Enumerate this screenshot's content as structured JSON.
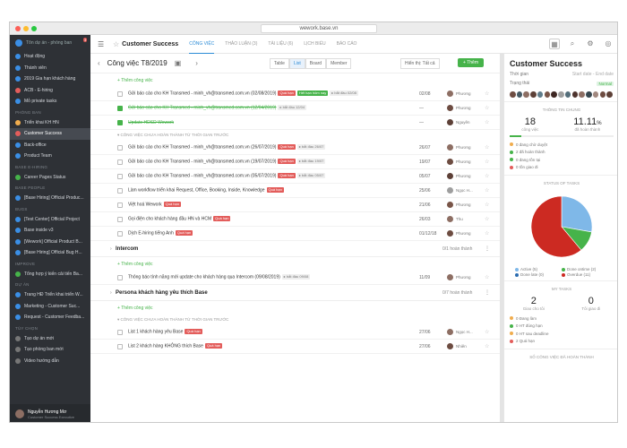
{
  "browser": {
    "url": "wework.base.vn"
  },
  "sidebar": {
    "org_name": "Tôn dự án - phòng ban",
    "badge": "3",
    "items_top": [
      {
        "label": "Hoạt động",
        "color": "#3b8fe6"
      },
      {
        "label": "Thành viên",
        "color": "#3b8fe6"
      },
      {
        "label": "2019 Gia hạn khách hàng",
        "color": "#3b8fe6"
      },
      {
        "label": "ACB - E-hiring",
        "color": "#e35d5b"
      },
      {
        "label": "Mỏ private tasks",
        "color": "#3b8fe6"
      }
    ],
    "head_phongban": "PHÒNG BAN",
    "items_phongban": [
      {
        "label": "Triển khai KH HN",
        "color": "#f0ad4e"
      },
      {
        "label": "Customer Success",
        "color": "#e35d5b",
        "active": true
      },
      {
        "label": "Back-office",
        "color": "#3b8fe6"
      },
      {
        "label": "Product Team",
        "color": "#3b8fe6"
      }
    ],
    "head_ehiring": "BASE E-HIRING",
    "items_ehiring": [
      {
        "label": "Career Pages Status",
        "color": "#46b34a"
      }
    ],
    "head_people": "BASE PEOPLE",
    "items_people": [
      {
        "label": "[Base Hiring] Official Produc...",
        "color": "#3b8fe6"
      }
    ],
    "head_bugs": "BUGS",
    "items_bugs": [
      {
        "label": "[Test Center] Official Project",
        "color": "#3b8fe6"
      },
      {
        "label": "Base inside v3",
        "color": "#3b8fe6"
      },
      {
        "label": "[Wework] Official Product B...",
        "color": "#3b8fe6"
      },
      {
        "label": "[Base Hiring] Official Bug H...",
        "color": "#3b8fe6"
      }
    ],
    "head_improve": "IMPROVE",
    "items_improve": [
      {
        "label": "Tổng hợp ý kiến cải tiến Ba...",
        "color": "#46b34a"
      }
    ],
    "head_duan": "DỰ ÁN",
    "items_duan": [
      {
        "label": "Trang HĐ Triển khai triển W...",
        "color": "#3b8fe6"
      },
      {
        "label": "Marketing - Customer Suc...",
        "color": "#3b8fe6"
      },
      {
        "label": "Request - Customer Feedba...",
        "color": "#3b8fe6"
      }
    ],
    "head_tuychon": "TÙY CHỌN",
    "items_tuychon": [
      {
        "label": "Tạo dự án mới",
        "color": "#777"
      },
      {
        "label": "Tạo phòng ban mới",
        "color": "#777"
      },
      {
        "label": "Video hướng dẫn",
        "color": "#777"
      }
    ],
    "user": {
      "name": "Nguyễn Hương Mơ",
      "role": "Customer Success Executive"
    }
  },
  "header": {
    "title": "Customer Success",
    "tabs": [
      "CÔNG VIỆC",
      "THẢO LUẬN (3)",
      "TÀI LIỆU (6)",
      "LỊCH BIỂU",
      "BÁO CÁO"
    ]
  },
  "toolbar": {
    "title": "Công việc T8/2019",
    "views": [
      "Table",
      "List",
      "Board",
      "Member"
    ],
    "filter": "Hiển thị: Tất cả",
    "add": "+ Thêm"
  },
  "add_task_label": "+ Thêm công việc",
  "overdue_label": "CÔNG VIỆC CHƯA HOÀN THÀNH TỪ THỜI GIAN TRƯỚC",
  "group1_tasks": [
    {
      "name": "Gửi báo cáo cho KH Transmed - minh_vh@transmed.com.vn (02/08/2019)",
      "tags": [
        [
          "Quá hạn",
          "red"
        ],
        [
          "Hết hạn hôm nay",
          "grn"
        ],
        [
          "▸ bắt đầu 02/08",
          "gray"
        ]
      ],
      "date": "02/08",
      "owner": "Phương",
      "done": false
    },
    {
      "name": "Gửi báo cáo cho KH Transmed - minh_vh@transmed.com.vn (12/04/2019)",
      "tags": [
        [
          "▸ bắt đầu 12/04",
          "gray"
        ]
      ],
      "date": "—",
      "owner": "Phương",
      "done": true
    },
    {
      "name": "Update HDSD Wework",
      "tags": [],
      "date": "—",
      "owner": "Nguyên",
      "done": true
    }
  ],
  "group1_overdue": [
    {
      "name": "Gửi báo cáo cho KH Transmed - minh_vh@transmed.com.vn (26/07/2019)",
      "tags": [
        [
          "Quá hạn",
          "red"
        ],
        [
          "▸ bắt đầu 26/07",
          "gray"
        ]
      ],
      "date": "26/07",
      "owner": "Phương"
    },
    {
      "name": "Gửi báo cáo cho KH Transmed - minh_vh@transmed.com.vn (19/07/2019)",
      "tags": [
        [
          "Quá hạn",
          "red"
        ],
        [
          "▸ bắt đầu 19/07",
          "gray"
        ]
      ],
      "date": "19/07",
      "owner": "Phương"
    },
    {
      "name": "Gửi báo cáo cho KH Transmed - minh_vh@transmed.com.vn (05/07/2019)",
      "tags": [
        [
          "Quá hạn",
          "red"
        ],
        [
          "▸ bắt đầu 05/07",
          "gray"
        ]
      ],
      "date": "05/07",
      "owner": "Phương"
    },
    {
      "name": "Làm workflow triển khai Request, Office, Booking, Inside, Knowledge",
      "tags": [
        [
          "Quá hạn",
          "red"
        ]
      ],
      "date": "25/06",
      "owner": "Ngọc H..."
    },
    {
      "name": "Việt hoá Wework",
      "tags": [
        [
          "Quá hạn",
          "red"
        ]
      ],
      "date": "21/06",
      "owner": "Phương"
    },
    {
      "name": "Gọi điện cho khách hàng đầu HN và HCM",
      "tags": [
        [
          "Quá hạn",
          "red"
        ]
      ],
      "date": "26/03",
      "owner": "Thu"
    },
    {
      "name": "Dịch E-hiring tiếng Anh",
      "tags": [
        [
          "Quá hạn",
          "red"
        ]
      ],
      "date": "01/12/18",
      "owner": "Phương"
    }
  ],
  "group2": {
    "name": "Intercom",
    "progress": "0/1 hoàn thành"
  },
  "group2_tasks": [
    {
      "name": "Thông báo tính năng mới update cho khách hàng qua Intercom (09/08/2019)",
      "tags": [
        [
          "▸ bắt đầu 09/08",
          "gray"
        ]
      ],
      "date": "11/09",
      "owner": "Phương"
    }
  ],
  "group3": {
    "name": "Persona khách hàng yêu thích Base",
    "progress": "0/7 hoàn thành"
  },
  "group3_overdue": [
    {
      "name": "List 1 khách hàng yêu Base",
      "tags": [
        [
          "Quá hạn",
          "red"
        ]
      ],
      "date": "27/06",
      "owner": "Ngọc H..."
    },
    {
      "name": "List 2 khách hàng KHÔNG thích Base",
      "tags": [
        [
          "Quá hạn",
          "red"
        ]
      ],
      "date": "27/06",
      "owner": "Nhiên"
    }
  ],
  "right": {
    "title": "Customer Success",
    "thoigian_label": "Thời gian",
    "thoigian_value": "Start date - End date",
    "trangthai_label": "Trạng thái",
    "trangthai_value": "Normal",
    "info_head": "THÔNG TIN CHUNG",
    "stat1_value": "18",
    "stat1_label": "công việc",
    "stat2_value": "11.11",
    "stat2_unit": "%",
    "stat2_label": "đã hoàn thành",
    "legend": [
      {
        "label": "0 đang chờ duyệt",
        "color": "#f0ad4e"
      },
      {
        "label": "2 đã hoàn thành",
        "color": "#46b34a"
      },
      {
        "label": "0 đang tồn tại",
        "color": "#46b34a"
      },
      {
        "label": "0 tồn giao đi",
        "color": "#e35d5b"
      }
    ],
    "status_head": "STATUS OF TASKS",
    "pie_legend": [
      {
        "label": "Active (5)",
        "color": "#7fb8e8"
      },
      {
        "label": "Done ontime (2)",
        "color": "#46b34a"
      },
      {
        "label": "Done late (0)",
        "color": "#2b6cb0"
      },
      {
        "label": "Overdue (11)",
        "color": "#cc2a22"
      }
    ],
    "pie_values": [
      5,
      2,
      0,
      11
    ],
    "mytasks_head": "MY TASKS",
    "my1_value": "2",
    "my1_label": "Giao cho tôi",
    "my2_value": "0",
    "my2_label": "Tôi giao đi",
    "my_legend": [
      {
        "label": "0 Đang làm",
        "color": "#f0ad4e"
      },
      {
        "label": "0 HT đúng hạn",
        "color": "#46b34a"
      },
      {
        "label": "0 HT sau deadline",
        "color": "#f0ad4e"
      },
      {
        "label": "2 Quá hạn",
        "color": "#e35d5b"
      }
    ],
    "done_head": "SỐ CÔNG VIỆC ĐÃ HOÀN THÀNH"
  }
}
